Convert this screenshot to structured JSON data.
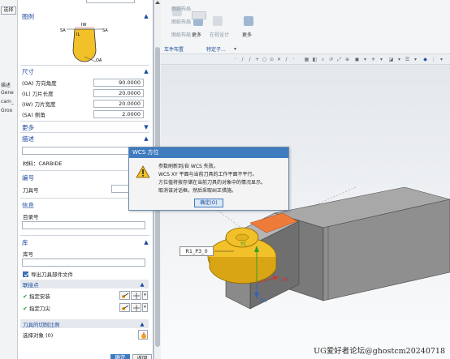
{
  "left_strip": {
    "btn_text": "选择",
    "side_texts": [
      "描述",
      "Gene",
      "cam_",
      "Groo"
    ]
  },
  "panel": {
    "top_field": "",
    "sections": {
      "figure": {
        "title": "图例"
      },
      "size": {
        "title": "尺寸",
        "rows": [
          {
            "label": "(OA) 方向角度",
            "value": "90.0000"
          },
          {
            "label": "(IL) 刀片长度",
            "value": "20.0000"
          },
          {
            "label": "(IW) 刀片宽度",
            "value": "20.0000"
          },
          {
            "label": "(SA) 侧角",
            "value": "2.0000"
          }
        ]
      },
      "more": {
        "title": "更多"
      },
      "desc": {
        "title": "描述",
        "material": "材料：CARBIDE"
      },
      "number": {
        "title": "编号",
        "tool_no_label": "刀具号"
      },
      "info": {
        "title": "信息",
        "catalog_label": "目录号"
      },
      "library": {
        "title": "库",
        "lib_no_label": "库号",
        "export_label": "导出刀具部件文件",
        "assoc_title": "联接点",
        "assoc_items": [
          {
            "label": "指定安装"
          },
          {
            "label": "指定刀尖"
          }
        ],
        "cut_ratio_title": "刀具的切削比例",
        "select_obj_label": "选择对象 (0)"
      }
    },
    "figure_labels": {
      "sa_left": "SA",
      "sa_right": "SA",
      "iw": "IW",
      "il": "IL",
      "oa": "OA"
    },
    "footer_buttons": {
      "ok": "确定",
      "back": "返回"
    }
  },
  "ribbon": {
    "faded": [
      "图纸布局",
      "图纸布局",
      "图纸布局"
    ],
    "more1": "更多",
    "more2": "更多",
    "faded2": "在视设计",
    "tabs": [
      "车件布置",
      "特定子..."
    ]
  },
  "wcs_dialog": {
    "title": "WCS 方位",
    "lines": [
      "参数刷新到/自 WCS 失败。",
      "WCS XY 平面与当前刀具的工作平面不平行。",
      "方位值将按存储在当前刀具的对象中的情况显示。",
      "取消该对话框。然后采取纠正措施。"
    ],
    "confirm_label": "确定(O)"
  },
  "viewport": {
    "tag_label": "R1_P3_0",
    "axis_y": "YC",
    "axis_z": "ZM",
    "axis_x": "XM"
  },
  "watermark": "UG爱好者论坛@ghostcm20240718",
  "colors": {
    "accent_blue": "#3e7bbf",
    "section_title": "#1b4b9b",
    "insert_yellow": "#f2c029",
    "orange_face": "#ef7b3a",
    "body_gray": "#8e8e8e"
  }
}
